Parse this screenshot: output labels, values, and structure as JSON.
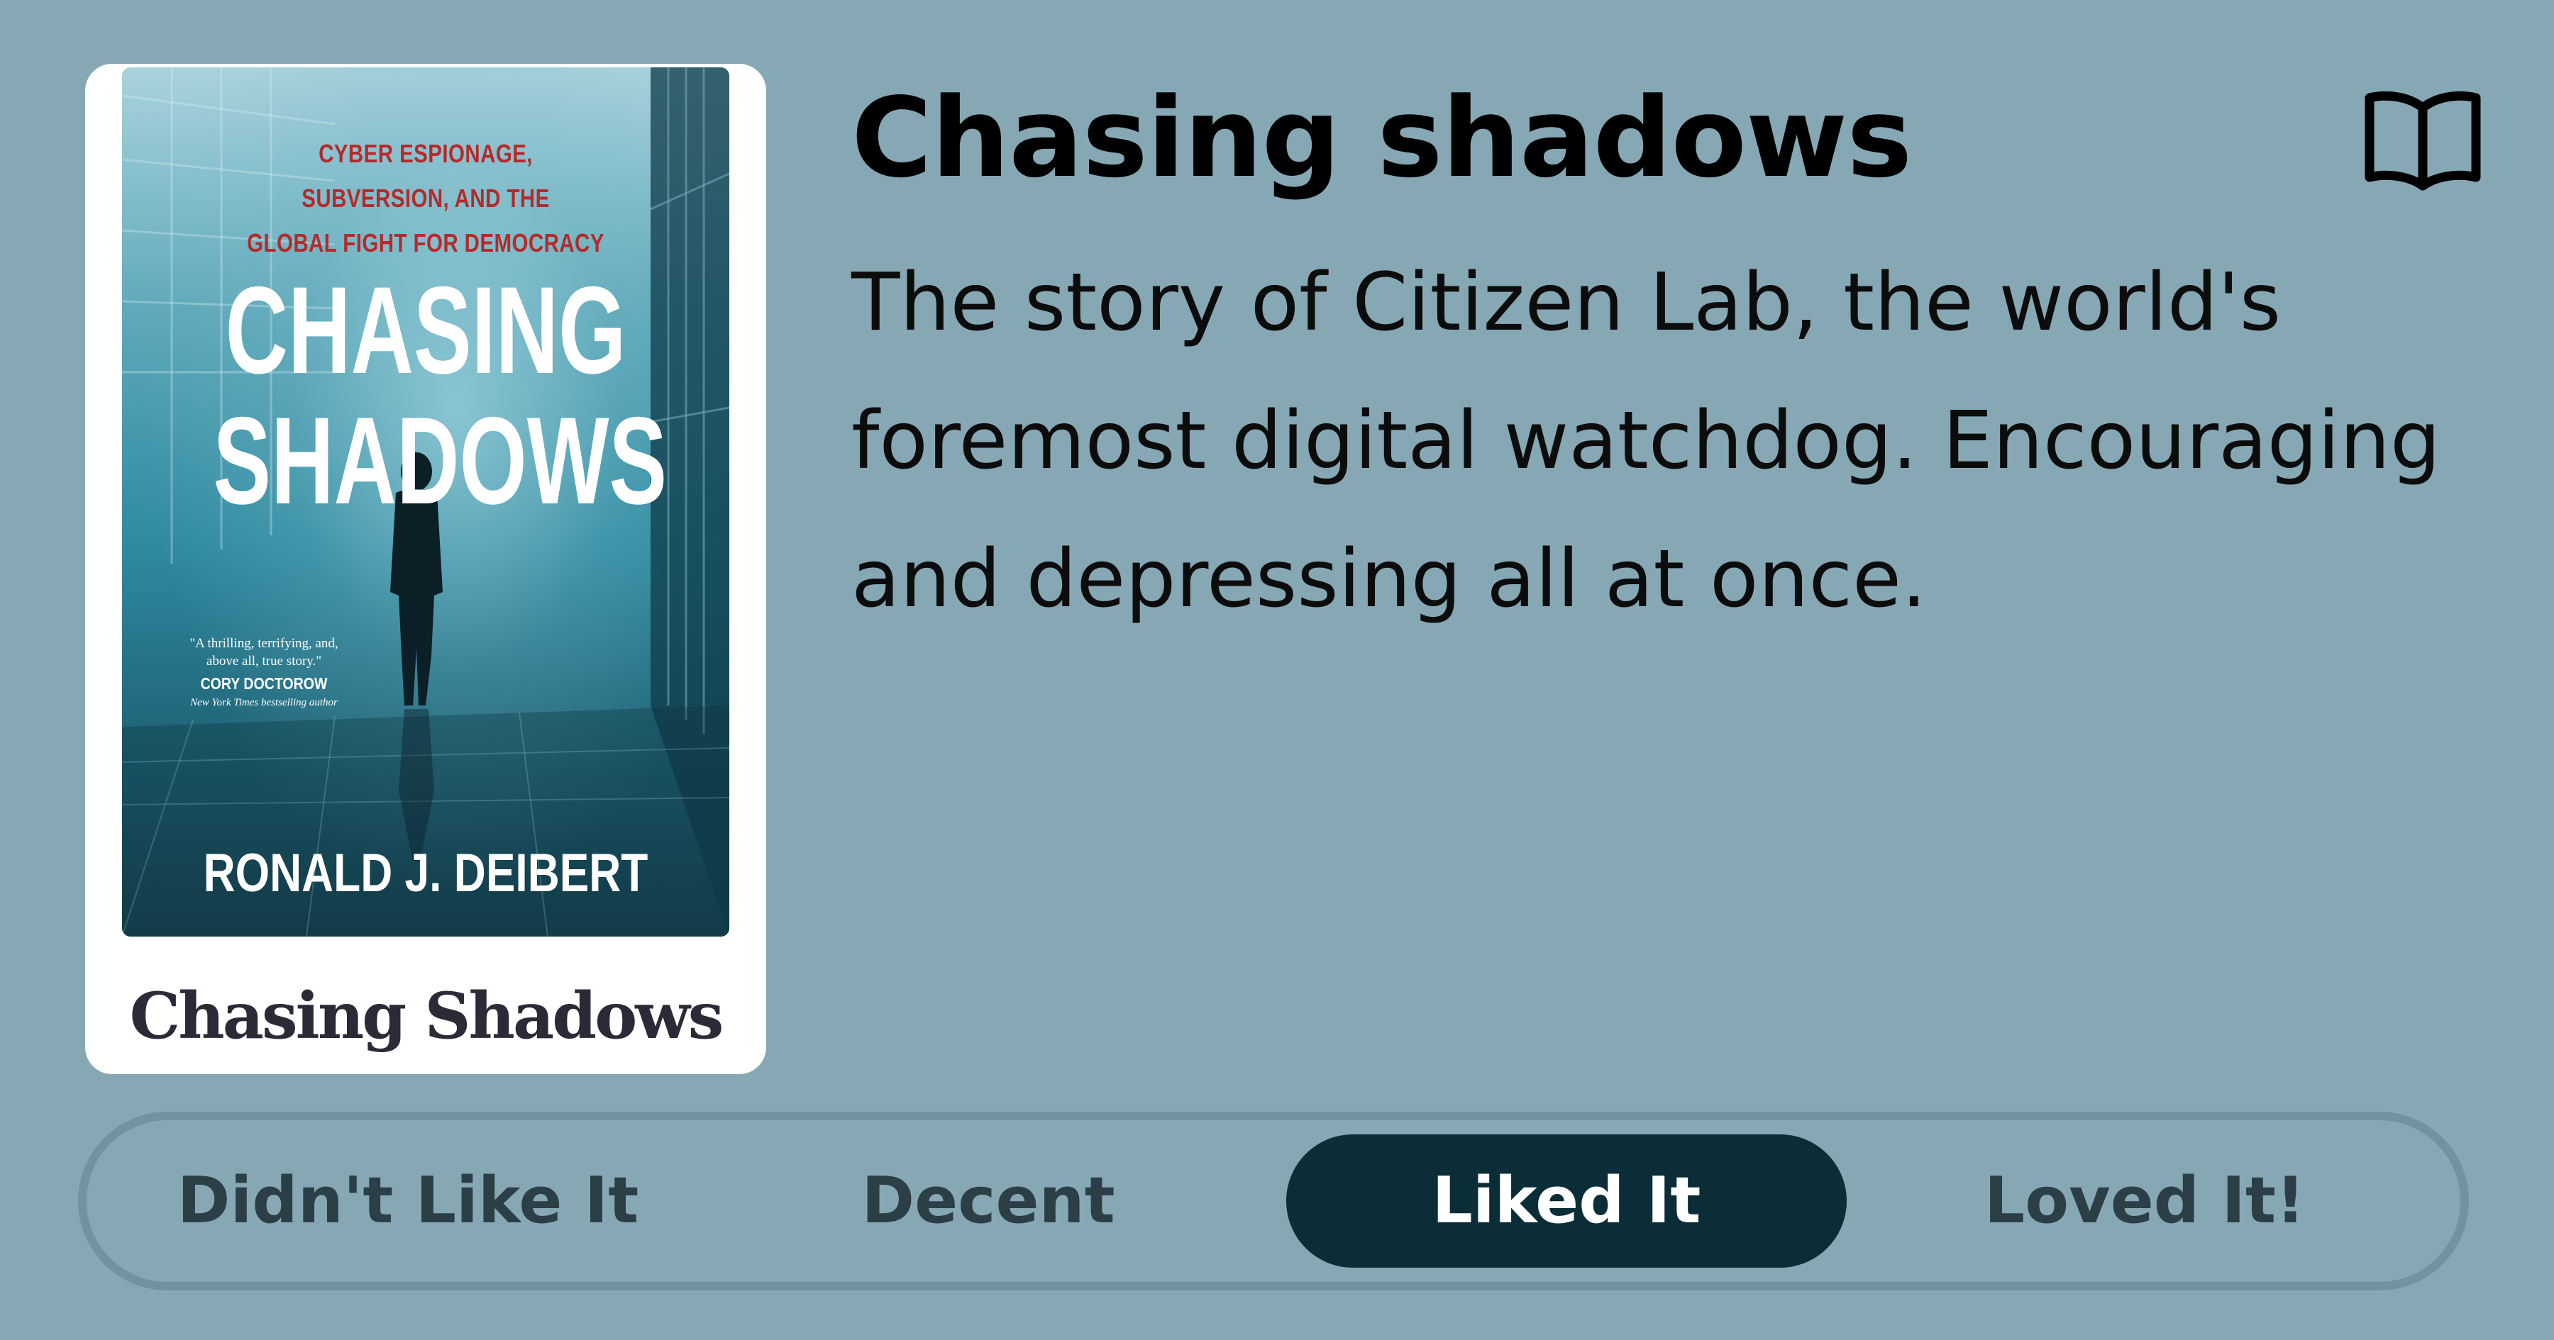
{
  "card": {
    "cover": {
      "subtitle": "CYBER ESPIONAGE,\nSUBVERSION, AND THE\nGLOBAL FIGHT FOR DEMOCRACY",
      "title": "CHASING\nSHADOWS",
      "quote": "\"A thrilling, terrifying, and,\nabove all, true story.\"",
      "quote_author": "CORY DOCTOROW",
      "quote_credit": "New York Times bestselling author",
      "author": "RONALD J. DEIBERT"
    },
    "title": "Chasing Shadows"
  },
  "book": {
    "title": "Chasing shadows",
    "description": "The story of Citizen Lab, the world's foremost digital watchdog. Encouraging and depressing all at once.",
    "icon": "open-book-icon"
  },
  "rating": {
    "options": [
      "Didn't Like It",
      "Decent",
      "Liked It",
      "Loved It!"
    ],
    "selected": "Liked It"
  },
  "colors": {
    "background": "#86a8b4",
    "rating_border": "#70939f",
    "selected_pill": "#0b2d38",
    "unselected_text": "#2c3f46",
    "cover_subtitle": "#b52a2a"
  }
}
